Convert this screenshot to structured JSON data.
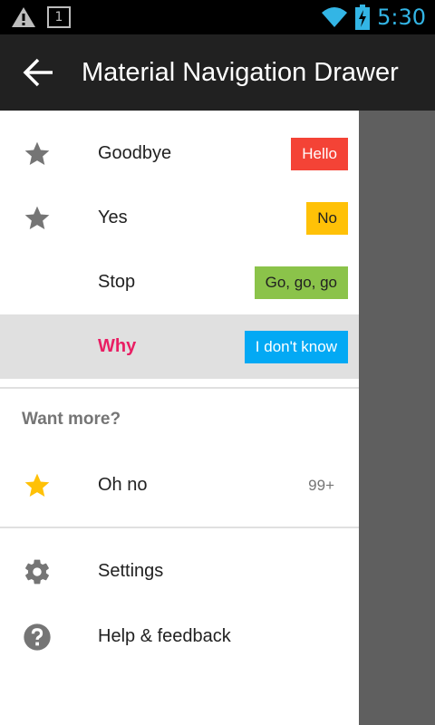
{
  "status_bar": {
    "time": "5:30",
    "left_icons": [
      "warning-icon",
      "notification-box-icon"
    ],
    "right_icons": [
      "wifi-icon",
      "battery-charging-icon"
    ],
    "notification_number": "1"
  },
  "toolbar": {
    "title": "Material Navigation Drawer",
    "back_icon": "arrow-back-icon"
  },
  "drawer": {
    "items": [
      {
        "label": "Goodbye",
        "icon": "star-icon",
        "badge": "Hello",
        "badge_color": "#f44336",
        "selected": false
      },
      {
        "label": "Yes",
        "icon": "star-icon",
        "badge": "No",
        "badge_color": "#ffc107",
        "selected": false
      },
      {
        "label": "Stop",
        "icon": "",
        "badge": "Go, go, go",
        "badge_color": "#8bc34a",
        "selected": false
      },
      {
        "label": "Why",
        "icon": "",
        "badge": "I don't know",
        "badge_color": "#03a9f4",
        "selected": true
      }
    ],
    "subheader": "Want more?",
    "extra_item": {
      "label": "Oh no",
      "icon": "star-icon",
      "badge": "99+",
      "icon_color": "#ffc107"
    },
    "footer_items": [
      {
        "label": "Settings",
        "icon": "gear-icon"
      },
      {
        "label": "Help & feedback",
        "icon": "help-icon"
      }
    ]
  },
  "colors": {
    "selected_text": "#e91e63",
    "toolbar_bg": "#212121",
    "status_accent": "#33b5e5"
  }
}
